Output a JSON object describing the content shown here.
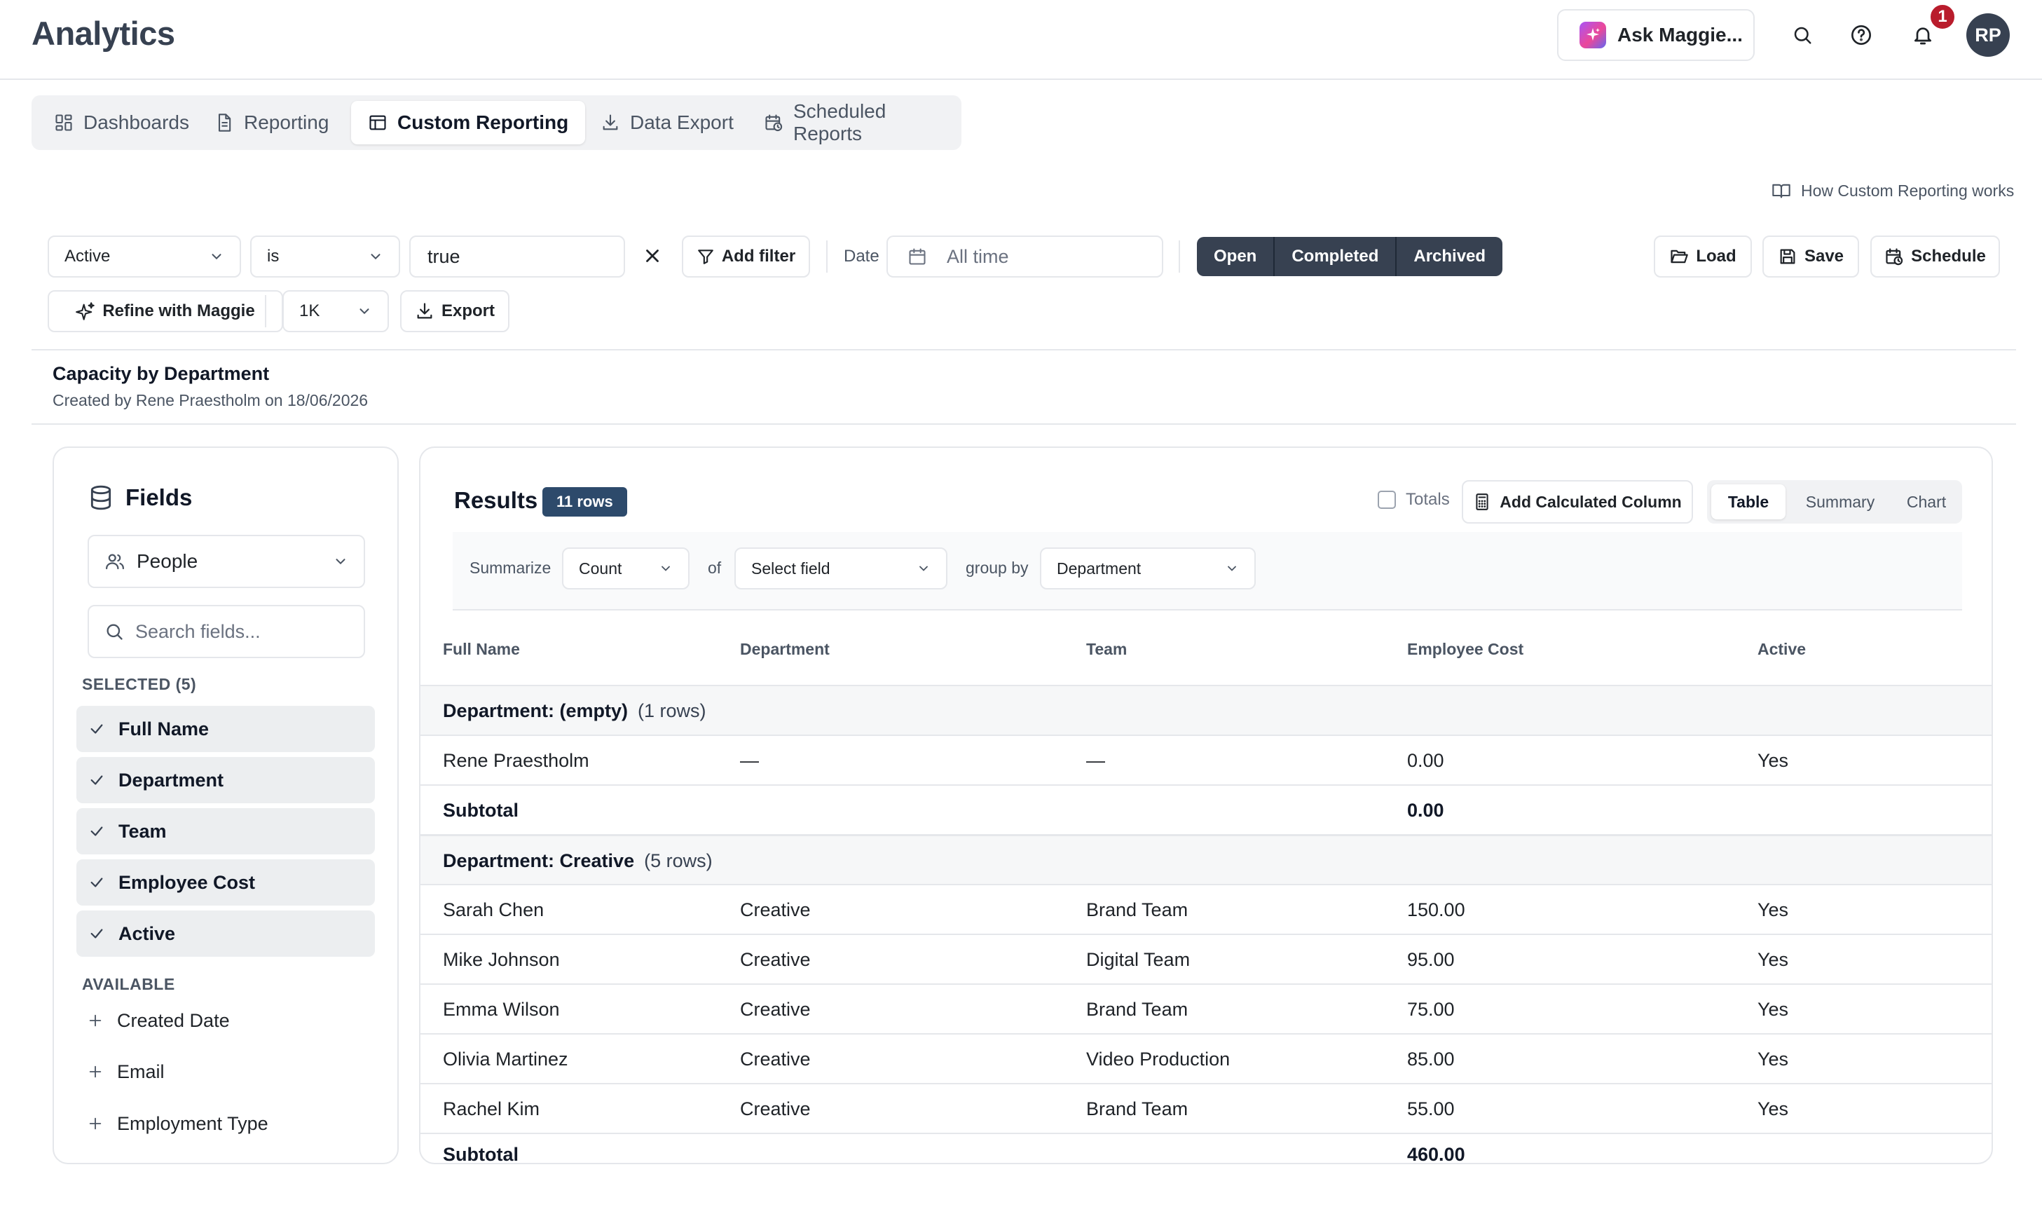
{
  "header": {
    "app_title": "Analytics",
    "ask_label": "Ask Maggie...",
    "notification_count": "1",
    "avatar_initials": "RP"
  },
  "tabs": [
    {
      "label": "Dashboards",
      "icon": "dashboard-icon"
    },
    {
      "label": "Reporting",
      "icon": "document-icon"
    },
    {
      "label": "Custom Reporting",
      "icon": "table-icon",
      "active": true
    },
    {
      "label": "Data Export",
      "icon": "download-icon"
    },
    {
      "label": "Scheduled Reports",
      "icon": "calendar-clock-icon"
    }
  ],
  "howto_link": "How Custom Reporting works",
  "filter": {
    "field": "Active",
    "operator": "is",
    "value": "true",
    "add_filter": "Add filter",
    "date_label": "Date",
    "date_value": "All time",
    "status_segments": [
      "Open",
      "Completed",
      "Archived"
    ],
    "load": "Load",
    "save": "Save",
    "schedule": "Schedule",
    "refine": "Refine with Maggie",
    "limit": "1K",
    "export": "Export"
  },
  "report": {
    "title": "Capacity by Department",
    "subtitle": "Created by Rene Praestholm on 18/06/2026"
  },
  "fields_panel": {
    "title": "Fields",
    "source": "People",
    "search_placeholder": "Search fields...",
    "selected_label": "SELECTED (5)",
    "selected": [
      "Full Name",
      "Department",
      "Team",
      "Employee Cost",
      "Active"
    ],
    "available_label": "AVAILABLE",
    "available": [
      "Created Date",
      "Email",
      "Employment Type"
    ]
  },
  "results": {
    "title": "Results",
    "row_badge": "11 rows",
    "totals_label": "Totals",
    "add_calc": "Add Calculated Column",
    "views": [
      "Table",
      "Summary",
      "Chart"
    ],
    "summarize_label": "Summarize",
    "summarize_fn": "Count",
    "of_label": "of",
    "of_field": "Select field",
    "group_label": "group by",
    "group_field": "Department",
    "columns": [
      "Full Name",
      "Department",
      "Team",
      "Employee Cost",
      "Active"
    ],
    "groups": [
      {
        "label": "Department: (empty)",
        "count": "(1 rows)",
        "rows": [
          [
            "Rene Praestholm",
            "—",
            "—",
            "0.00",
            "Yes"
          ]
        ],
        "subtotal_label": "Subtotal",
        "subtotal_value": "0.00"
      },
      {
        "label": "Department: Creative",
        "count": "(5 rows)",
        "rows": [
          [
            "Sarah Chen",
            "Creative",
            "Brand Team",
            "150.00",
            "Yes"
          ],
          [
            "Mike Johnson",
            "Creative",
            "Digital Team",
            "95.00",
            "Yes"
          ],
          [
            "Emma Wilson",
            "Creative",
            "Brand Team",
            "75.00",
            "Yes"
          ],
          [
            "Olivia Martinez",
            "Creative",
            "Video Production",
            "85.00",
            "Yes"
          ],
          [
            "Rachel Kim",
            "Creative",
            "Brand Team",
            "55.00",
            "Yes"
          ]
        ],
        "subtotal_label": "Subtotal",
        "subtotal_value": "460.00"
      }
    ]
  }
}
